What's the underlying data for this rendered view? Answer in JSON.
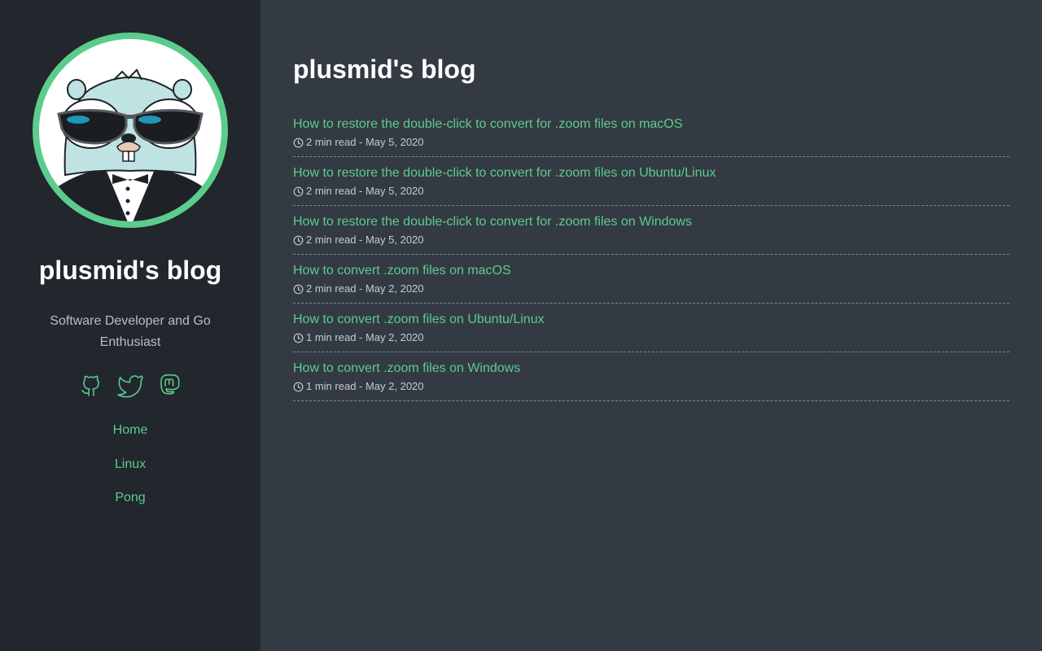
{
  "sidebar": {
    "site_title": "plusmid's blog",
    "tagline": "Software Developer and Go Enthusiast",
    "social": [
      {
        "icon": "github-icon"
      },
      {
        "icon": "twitter-icon"
      },
      {
        "icon": "mastodon-icon"
      }
    ],
    "nav": [
      {
        "label": "Home"
      },
      {
        "label": "Linux"
      },
      {
        "label": "Pong"
      }
    ]
  },
  "main": {
    "title": "plusmid's blog",
    "posts": [
      {
        "title": "How to restore the double-click to convert for .zoom files on macOS",
        "meta": "2 min read - May 5, 2020"
      },
      {
        "title": "How to restore the double-click to convert for .zoom files on Ubuntu/Linux",
        "meta": "2 min read - May 5, 2020"
      },
      {
        "title": "How to restore the double-click to convert for .zoom files on Windows",
        "meta": "2 min read - May 5, 2020"
      },
      {
        "title": "How to convert .zoom files on macOS",
        "meta": "2 min read - May 2, 2020"
      },
      {
        "title": "How to convert .zoom files on Ubuntu/Linux",
        "meta": "1 min read - May 2, 2020"
      },
      {
        "title": "How to convert .zoom files on Windows",
        "meta": "1 min read - May 2, 2020"
      }
    ]
  },
  "colors": {
    "accent": "#5ccc8d",
    "sidebar_bg": "#22262d",
    "main_bg": "#343a43",
    "text": "#ffffff",
    "muted": "#b9bec6"
  }
}
